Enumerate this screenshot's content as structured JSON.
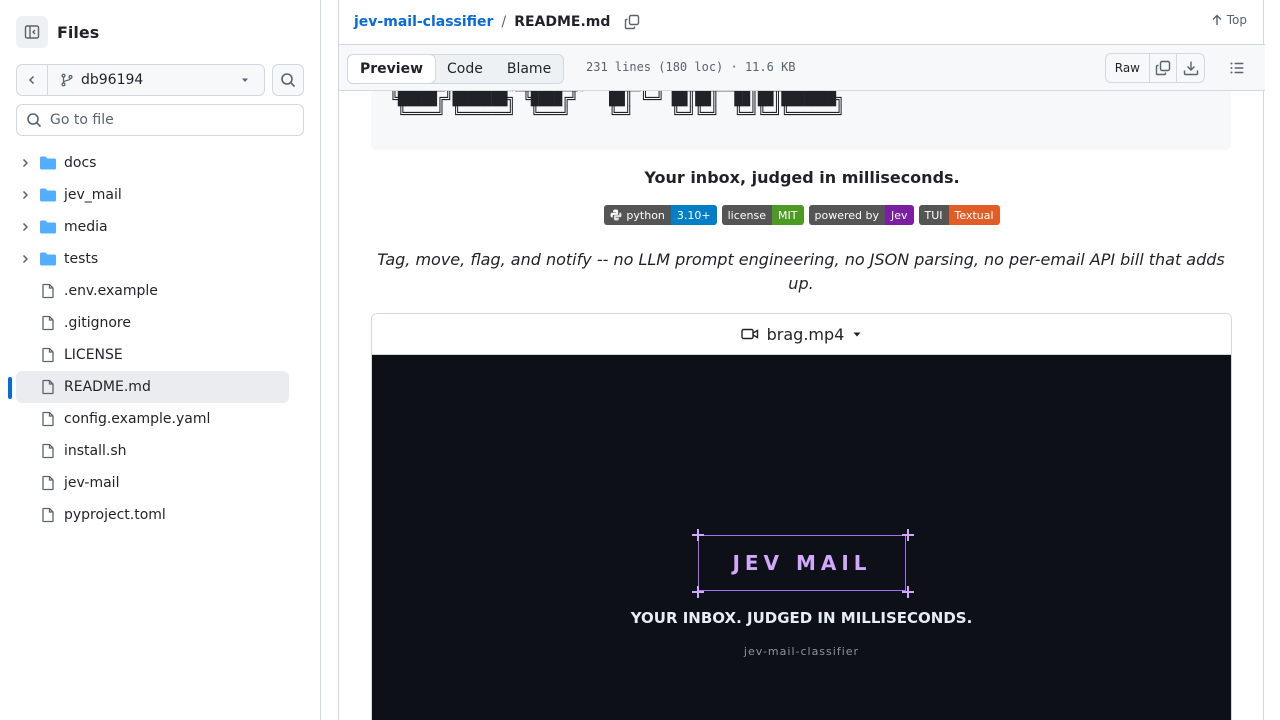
{
  "sidebar": {
    "title": "Files",
    "branch": "db96194",
    "search_placeholder": "Go to file",
    "items": [
      {
        "label": "docs",
        "type": "folder"
      },
      {
        "label": "jev_mail",
        "type": "folder"
      },
      {
        "label": "media",
        "type": "folder"
      },
      {
        "label": "tests",
        "type": "folder"
      },
      {
        "label": ".env.example",
        "type": "file"
      },
      {
        "label": ".gitignore",
        "type": "file"
      },
      {
        "label": "LICENSE",
        "type": "file"
      },
      {
        "label": "README.md",
        "type": "file",
        "active": true
      },
      {
        "label": "config.example.yaml",
        "type": "file"
      },
      {
        "label": "install.sh",
        "type": "file"
      },
      {
        "label": "jev-mail",
        "type": "file"
      },
      {
        "label": "pyproject.toml",
        "type": "file"
      }
    ]
  },
  "header": {
    "repo": "jev-mail-classifier",
    "separator": "/",
    "file": "README.md",
    "top_label": "Top"
  },
  "toolbar": {
    "tabs": [
      "Preview",
      "Code",
      "Blame"
    ],
    "active_tab": "Preview",
    "meta": "231 lines (180 loc) · 11.6 KB",
    "raw_label": "Raw"
  },
  "readme": {
    "tagline": "Your inbox, judged in milliseconds.",
    "badges": [
      {
        "label": "python",
        "value": "3.10+",
        "color": "#007ec6"
      },
      {
        "label": "license",
        "value": "MIT",
        "color": "#4c9a21"
      },
      {
        "label": "powered by",
        "value": "Jev",
        "color": "#7b1fa2"
      },
      {
        "label": "TUI",
        "value": "Textual",
        "color": "#e05d26"
      }
    ],
    "description": "Tag, move, flag, and notify -- no LLM prompt engineering, no JSON parsing, no per-email API bill that adds up.",
    "video": {
      "filename": "brag.mp4",
      "logo": "JEV MAIL",
      "tagline": "YOUR INBOX. JUDGED IN MILLISECONDS.",
      "subtitle": "jev-mail-classifier"
    }
  },
  "colors": {
    "accent": "#0969da",
    "folder": "#54aeff",
    "video_bg": "#0d1117",
    "logo": "#d2a8ff"
  }
}
